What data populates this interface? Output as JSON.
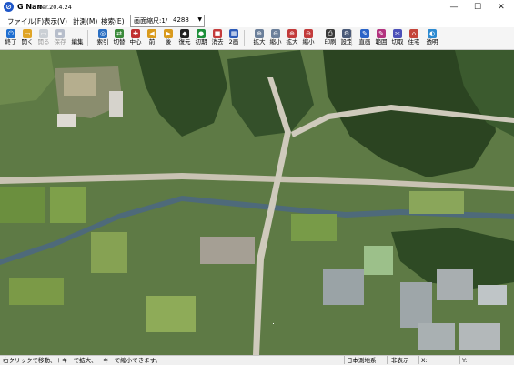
{
  "window": {
    "title": "G Nan",
    "version": "Ver.20.4.24",
    "icon": "app-logo-icon",
    "controls": {
      "minimize": "—",
      "maximize": "☐",
      "close": "✕"
    }
  },
  "menu": {
    "items": [
      "ファイル(F)",
      "表示(V)",
      "計測(M)",
      "検索(E)"
    ],
    "scale": {
      "label": "画面縮尺:1/",
      "value": "4288",
      "arrow": "▼"
    }
  },
  "toolbar": {
    "items": [
      {
        "label": "終了",
        "icon": "exit-icon",
        "color": "#1f6fd1",
        "glyph": "⏻",
        "enabled": true
      },
      {
        "label": "開く",
        "icon": "open-folder-icon",
        "color": "#e0a526",
        "glyph": "▭",
        "enabled": true
      },
      {
        "label": "開る",
        "icon": "close-file-icon",
        "color": "#9aa4b0",
        "glyph": "▭",
        "enabled": false
      },
      {
        "label": "保存",
        "icon": "save-icon",
        "color": "#6d7d99",
        "glyph": "▪",
        "enabled": false
      },
      {
        "label": "編集",
        "icon": "edit-icon",
        "color": "#f5f5f5",
        "glyph": "",
        "enabled": true
      },
      {
        "label": "索引",
        "icon": "index-icon",
        "color": "#2b6fc2",
        "glyph": "◎",
        "enabled": true
      },
      {
        "label": "切替",
        "icon": "switch-icon",
        "color": "#3a8a3a",
        "glyph": "⇄",
        "enabled": true
      },
      {
        "label": "中心",
        "icon": "center-icon",
        "color": "#c03030",
        "glyph": "✚",
        "enabled": true
      },
      {
        "label": "前",
        "icon": "back-icon",
        "color": "#d99a1c",
        "glyph": "◀",
        "enabled": true
      },
      {
        "label": "後",
        "icon": "forward-icon",
        "color": "#d99a1c",
        "glyph": "▶",
        "enabled": true
      },
      {
        "label": "復元",
        "icon": "restore-icon",
        "color": "#222222",
        "glyph": "◆",
        "enabled": true
      },
      {
        "label": "初期",
        "icon": "initial-icon",
        "color": "#1d8f3a",
        "glyph": "●",
        "enabled": true
      },
      {
        "label": "消去",
        "icon": "erase-icon",
        "color": "#c43c3c",
        "glyph": "■",
        "enabled": true
      },
      {
        "label": "2画",
        "icon": "dual-screen-icon",
        "color": "#2d5bb8",
        "glyph": "▦",
        "enabled": true
      },
      {
        "label": "拡大",
        "icon": "zoom-in-icon",
        "color": "#6b7f9a",
        "glyph": "⊕",
        "enabled": true
      },
      {
        "label": "縮小",
        "icon": "zoom-out-icon",
        "color": "#6b7f9a",
        "glyph": "⊖",
        "enabled": true
      },
      {
        "label": "拡大",
        "icon": "zoom-in-red-icon",
        "color": "#c23b3b",
        "glyph": "⊕",
        "enabled": true
      },
      {
        "label": "縮小",
        "icon": "zoom-out-red-icon",
        "color": "#c23b3b",
        "glyph": "⊖",
        "enabled": true
      },
      {
        "label": "印刷",
        "icon": "print-icon",
        "color": "#3a3a3a",
        "glyph": "⎙",
        "enabled": true
      },
      {
        "label": "設定",
        "icon": "settings-icon",
        "color": "#4a5a78",
        "glyph": "⚙",
        "enabled": true
      },
      {
        "label": "直画",
        "icon": "draw-line-icon",
        "color": "#2a64c8",
        "glyph": "✎",
        "enabled": true
      },
      {
        "label": "範囲",
        "icon": "range-icon",
        "color": "#b2337f",
        "glyph": "✎",
        "enabled": true
      },
      {
        "label": "切取",
        "icon": "cut-icon",
        "color": "#4b4fb8",
        "glyph": "✂",
        "enabled": true
      },
      {
        "label": "住宅",
        "icon": "house-icon",
        "color": "#c4453a",
        "glyph": "⌂",
        "enabled": true
      },
      {
        "label": "透明",
        "icon": "transparency-icon",
        "color": "#2d8ad1",
        "glyph": "◐",
        "enabled": true
      }
    ]
  },
  "map": {
    "description_icon": "aerial-photo-map"
  },
  "status": {
    "hint": "右クリックで移動、＋キーで拡大、－キーで縮小できます。",
    "datum": "日本測地系",
    "display": "非表示",
    "x_label": "X:",
    "y_label": "Y:"
  }
}
